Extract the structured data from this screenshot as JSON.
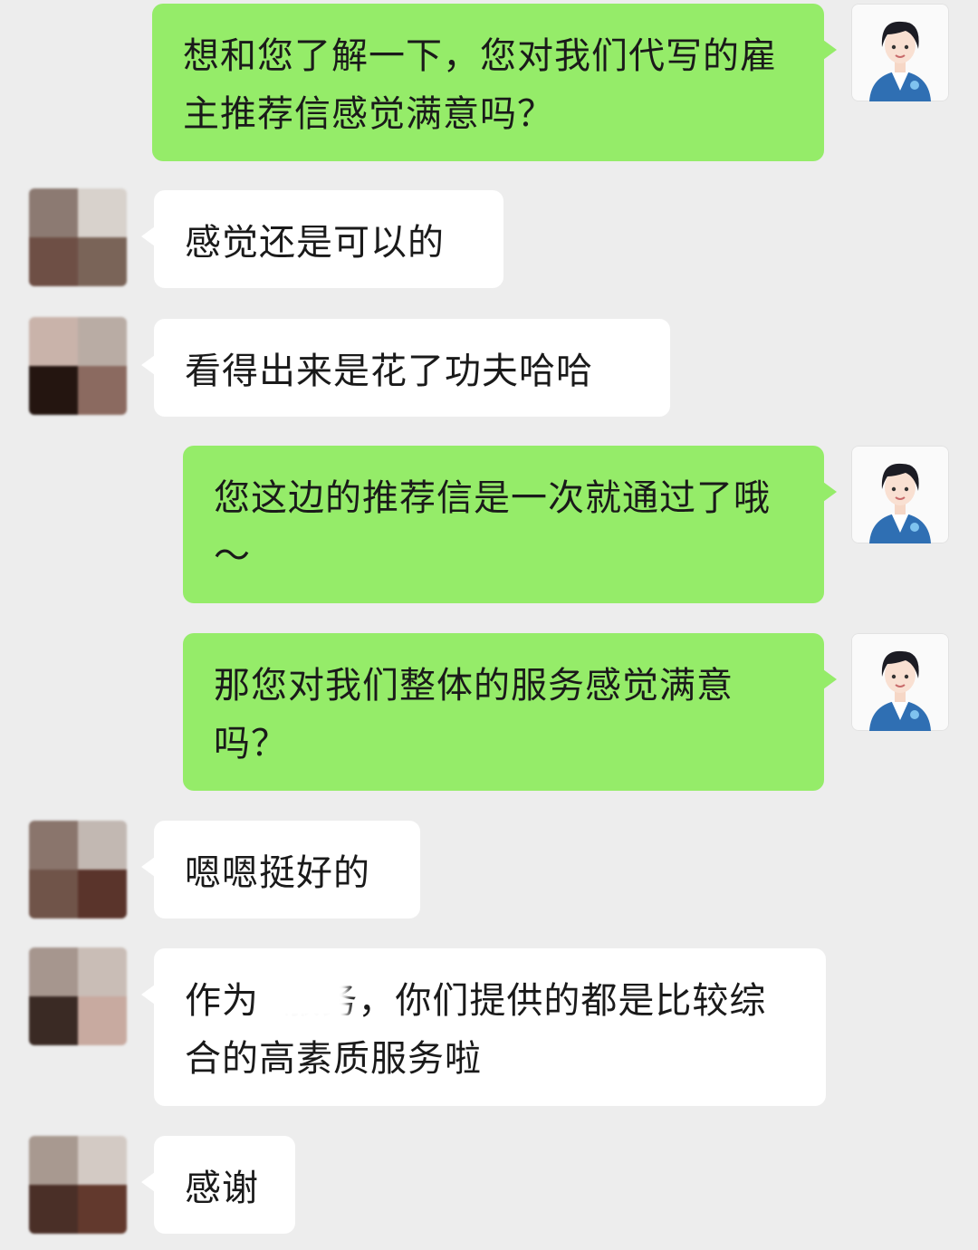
{
  "messages": [
    {
      "from": "me",
      "text": "想和您了解一下，您对我们代写的雇主推荐信感觉满意吗？"
    },
    {
      "from": "them",
      "text": "感觉还是可以的"
    },
    {
      "from": "them",
      "text": "看得出来是花了功夫哈哈"
    },
    {
      "from": "me",
      "text": "您这边的推荐信是一次就通过了哦～"
    },
    {
      "from": "me",
      "text": "那您对我们整体的服务感觉满意吗？"
    },
    {
      "from": "them",
      "text": "嗯嗯挺好的"
    },
    {
      "from": "them",
      "text": "作为  服务，你们提供的都是比较综合的高素质服务啦"
    },
    {
      "from": "them",
      "text": "感谢"
    }
  ],
  "colors": {
    "background": "#ededed",
    "my_bubble": "#95ec69",
    "their_bubble": "#ffffff",
    "agent_suit": "#2f6fb3"
  },
  "icons": {
    "agent_avatar": "customer-service-agent-avatar-icon",
    "user_avatar": "pixelated-user-avatar"
  }
}
